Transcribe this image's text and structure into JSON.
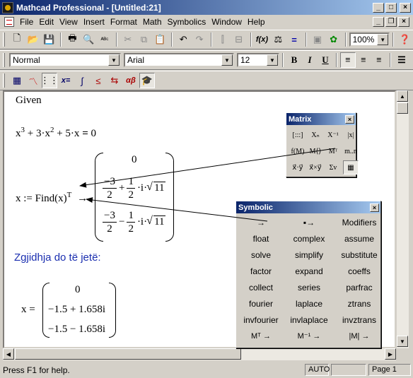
{
  "window": {
    "title": "Mathcad Professional - [Untitled:21]"
  },
  "menu": [
    "File",
    "Edit",
    "View",
    "Insert",
    "Format",
    "Math",
    "Symbolics",
    "Window",
    "Help"
  ],
  "standard_toolbar": {
    "zoom": "100%"
  },
  "formatting_toolbar": {
    "style": "Normal",
    "font": "Arial",
    "size": "12",
    "bold": "B",
    "italic": "I",
    "underline": "U"
  },
  "math_toolbar": {
    "eval_label": "x=",
    "calc_label": "∫",
    "greek_label": "αβ"
  },
  "worksheet": {
    "given": "Given",
    "equation_parts": [
      "x",
      "3",
      " + 3·x",
      "2",
      " + 5·x ",
      "=",
      " 0"
    ],
    "assign_prefix": "x := Find(x)",
    "transpose": "T",
    "arrow": "→",
    "sym_result": {
      "r0": "0",
      "r1_num": "−3",
      "r1_den": "2",
      "r1_op": "+",
      "r1_frac_num": "1",
      "r1_frac_den": "2",
      "r1_i": "·i·",
      "r1_sqrt": "11",
      "r2_num": "−3",
      "r2_den": "2",
      "r2_op": "−",
      "r2_frac_num": "1",
      "r2_frac_den": "2",
      "r2_i": "·i·",
      "r2_sqrt": "11"
    },
    "heading": "Zgjidhja do të jetë:",
    "num_label": "x =",
    "num_result": [
      "0",
      "−1.5 + 1.658i",
      "−1.5 − 1.658i"
    ]
  },
  "matrix_palette": {
    "title": "Matrix",
    "buttons": [
      "[:::]",
      "Xₙ",
      "X⁻¹",
      "|x|",
      "f(M)",
      "M⟨⟩",
      "Mᵀ",
      "m..n",
      "x⃗·y⃗",
      "x⃗×y⃗",
      "Σv",
      "▦"
    ]
  },
  "symbolic_palette": {
    "title": "Symbolic",
    "items": [
      "→",
      "▪→",
      "Modifiers",
      "float",
      "complex",
      "assume",
      "solve",
      "simplify",
      "substitute",
      "factor",
      "expand",
      "coeffs",
      "collect",
      "series",
      "parfrac",
      "fourier",
      "laplace",
      "ztrans",
      "invfourier",
      "invlaplace",
      "invztrans",
      "Mᵀ →",
      "M⁻¹ →",
      "|M| →"
    ]
  },
  "status": {
    "help": "Press F1 for help.",
    "mode": "AUTO",
    "page": "Page 1"
  }
}
